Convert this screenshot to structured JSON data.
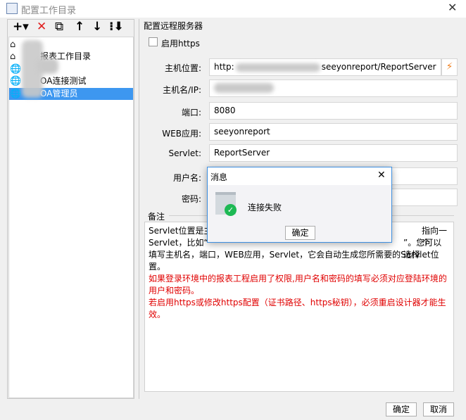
{
  "window": {
    "title": "配置工作目录",
    "close": "✕"
  },
  "toolbar": {
    "add": "+▾",
    "delete": "✕",
    "copy": "⧉",
    "up": "↑",
    "down": "↓",
    "sort": "⁝⬇"
  },
  "tree": {
    "items": [
      {
        "label": "",
        "icon": "home-icon"
      },
      {
        "label": "报表工作目录",
        "icon": "home-icon"
      },
      {
        "label": "",
        "icon": "globe-icon"
      },
      {
        "label": "OA连接测试",
        "icon": "globe-icon"
      },
      {
        "label": "OA管理员",
        "icon": "globe-icon",
        "selected": true
      }
    ]
  },
  "form": {
    "group_title": "配置远程服务器",
    "https_label": "启用https",
    "host_label": "主机位置:",
    "host_value_prefix": "http:",
    "host_value_suffix": "seeyonreport/ReportServer",
    "ip_label": "主机名/IP:",
    "port_label": "端口:",
    "port_value": "8080",
    "web_label": "WEB应用:",
    "web_value": "seeyonreport",
    "servlet_label": "Servlet:",
    "servlet_value": "ReportServer",
    "user_label": "用户名:",
    "password_label": "密码:",
    "remark_title": "备注",
    "remark": {
      "l1a": "Servlet位置是主",
      "l1b": "指向一个",
      "l2a": "Servlet，比如“",
      "l2b": "”。您可以选择",
      "l3": "填写主机名，端口，WEB应用，Servlet，它会自动生成您所需要的Servlet位置。",
      "l4": "如果登录环境中的报表工程启用了权限,用户名和密码的填写必须对应登陆环境的用户和密码。",
      "l5": "若启用https或修改https配置（证书路径、https秘钥），必须重启设计器才能生效。"
    }
  },
  "footer": {
    "ok": "确定",
    "cancel": "取消"
  },
  "dialog": {
    "title": "消息",
    "message": "连接失败",
    "ok": "确定",
    "close": "✕"
  },
  "colors": {
    "selection": "#3d97f0",
    "warning": "#e00000",
    "success": "#1db954"
  }
}
